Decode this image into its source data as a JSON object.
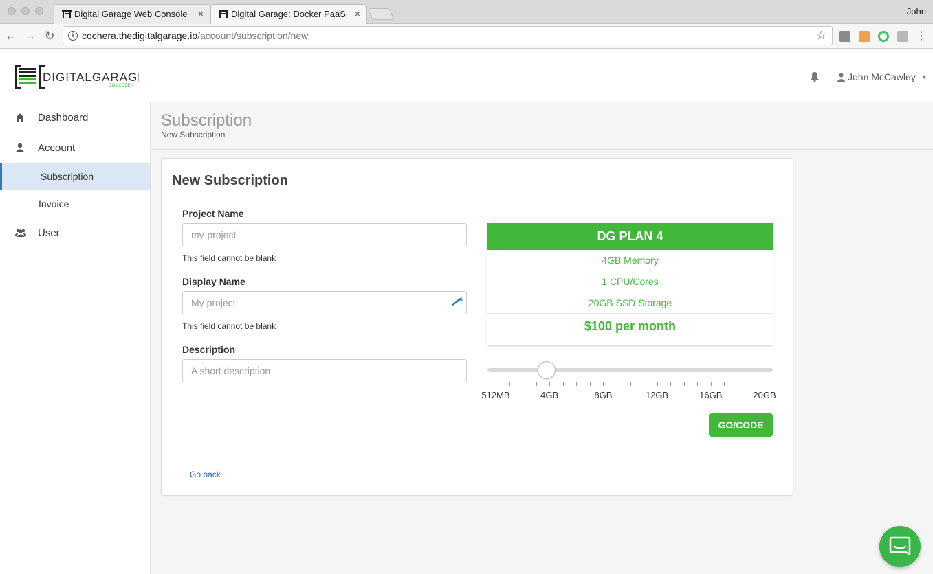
{
  "browser": {
    "tabs": [
      {
        "title": "Digital Garage Web Console",
        "close": "×"
      },
      {
        "title": "Digital Garage: Docker PaaS|K",
        "close": "×"
      }
    ],
    "profile_name": "John",
    "url_host": "cochera.thedigitalgarage.io",
    "url_path": "/account/subscription/new"
  },
  "header": {
    "user_name": "John McCawley"
  },
  "sidebar": {
    "items": [
      {
        "label": "Dashboard",
        "icon": "home-icon"
      },
      {
        "label": "Account",
        "icon": "user-icon"
      },
      {
        "label": "Subscription",
        "active": true
      },
      {
        "label": "Invoice"
      },
      {
        "label": "User",
        "icon": "users-icon"
      }
    ]
  },
  "page": {
    "title": "Subscription",
    "subtitle": "New Subscription"
  },
  "form": {
    "heading": "New Subscription",
    "project_name_label": "Project Name",
    "project_name_placeholder": "my-project",
    "project_name_help": "This field cannot be blank",
    "display_name_label": "Display Name",
    "display_name_placeholder": "My project",
    "display_name_help": "This field cannot be blank",
    "description_label": "Description",
    "description_placeholder": "A short description",
    "go_back": "Go back"
  },
  "plan": {
    "name": "DG PLAN 4",
    "memory": "4GB Memory",
    "cpu": "1 CPU/Cores",
    "storage": "20GB SSD Storage",
    "price": "$100 per month",
    "accent_color": "#42b83b"
  },
  "slider": {
    "labels": [
      "512MB",
      "4GB",
      "8GB",
      "12GB",
      "16GB",
      "20GB"
    ],
    "selected": "4GB",
    "value_fraction": 0.19
  },
  "submit_label": "GO/CODE"
}
